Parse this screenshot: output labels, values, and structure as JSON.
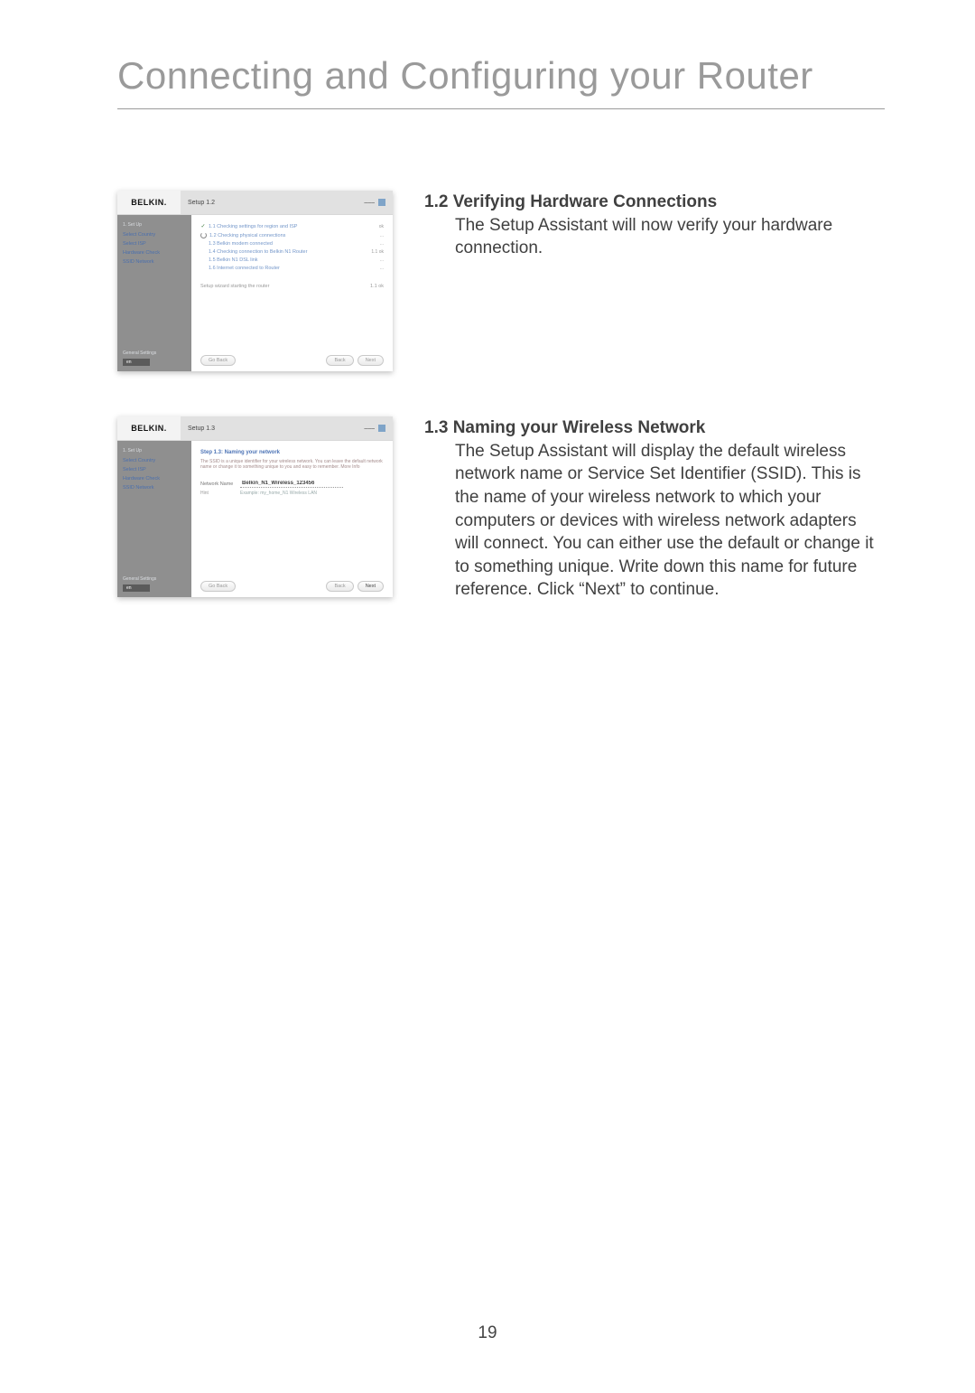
{
  "title": "Connecting and Configuring your Router",
  "page_number": "19",
  "sections": [
    {
      "number": "1.2",
      "heading": "Verifying Hardware Connections",
      "body": "The Setup Assistant will now verify your hardware connection."
    },
    {
      "number": "1.3",
      "heading": "Naming your Wireless Network",
      "body": "The Setup Assistant will display the default wireless network name or Service Set Identifier (SSID). This is the name of your wireless network to which your computers or devices with wireless network adapters will connect. You can either use the default or change it to something unique. Write down this name for future reference. Click “Next” to continue."
    }
  ],
  "shot_common": {
    "logo": "BELKIN.",
    "window_title": "Setup 1.2",
    "sidebar": {
      "group1": "1. Set Up",
      "link1": "Select Country",
      "link2": "Select ISP",
      "link3": "Hardware Check",
      "link4": "SSID Network",
      "group2": "General Settings",
      "lang": "en"
    },
    "buttons": {
      "go_back": "Go Back",
      "back": "Back",
      "next": "Next"
    }
  },
  "shot1": {
    "items": [
      {
        "text": "1.1 Checking settings for region and ISP",
        "status": "ok"
      },
      {
        "text": "1.2 Checking physical connections",
        "status": "..."
      },
      {
        "text": "1.3 Belkin modem connected",
        "status": "..."
      },
      {
        "text": "1.4 Checking connection to Belkin N1 Router",
        "status": "1.1 ok"
      },
      {
        "text": "1.5 Belkin N1 DSL link",
        "status": "..."
      },
      {
        "text": "1.6 Internet connected to Router",
        "status": "..."
      }
    ],
    "progress_label": "Setup wizard starting the router",
    "progress_status": "1.1 ok"
  },
  "shot2": {
    "window_title": "Setup 1.3",
    "header": "Step 1.3: Naming your network",
    "desc": "The SSID is a unique identifier for your wireless network. You can leave the default network name or change it to something unique to you and easy to remember. More Info",
    "more": "More Info",
    "field_label": "Network Name",
    "field_value": "Belkin_N1_Wireless_123456",
    "hint_label": "Hint",
    "hint_text": "Example: my_home_N1 Wireless LAN"
  }
}
